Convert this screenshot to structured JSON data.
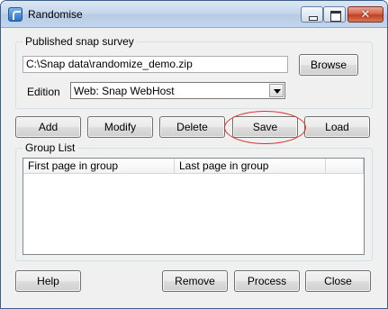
{
  "window": {
    "title": "Randomise",
    "close_glyph": "✕"
  },
  "survey": {
    "group_label": "Published snap survey",
    "file_path": "C:\\Snap data\\randomize_demo.zip",
    "browse_label": "Browse",
    "edition_label": "Edition",
    "edition_value": "Web: Snap WebHost"
  },
  "actions": {
    "add": "Add",
    "modify": "Modify",
    "delete": "Delete",
    "save": "Save",
    "load": "Load"
  },
  "group_list": {
    "group_label": "Group List",
    "columns": [
      "First page in group",
      "Last page in group",
      ""
    ],
    "rows": []
  },
  "footer": {
    "help": "Help",
    "remove": "Remove",
    "process": "Process",
    "close": "Close"
  },
  "annotation": {
    "highlight_color": "#d9322a",
    "highlight_target": "save-button"
  },
  "colors": {
    "title_bar": "#c6d8ec",
    "close_button": "#c2401f",
    "dialog_background": "#f0f0f0"
  }
}
